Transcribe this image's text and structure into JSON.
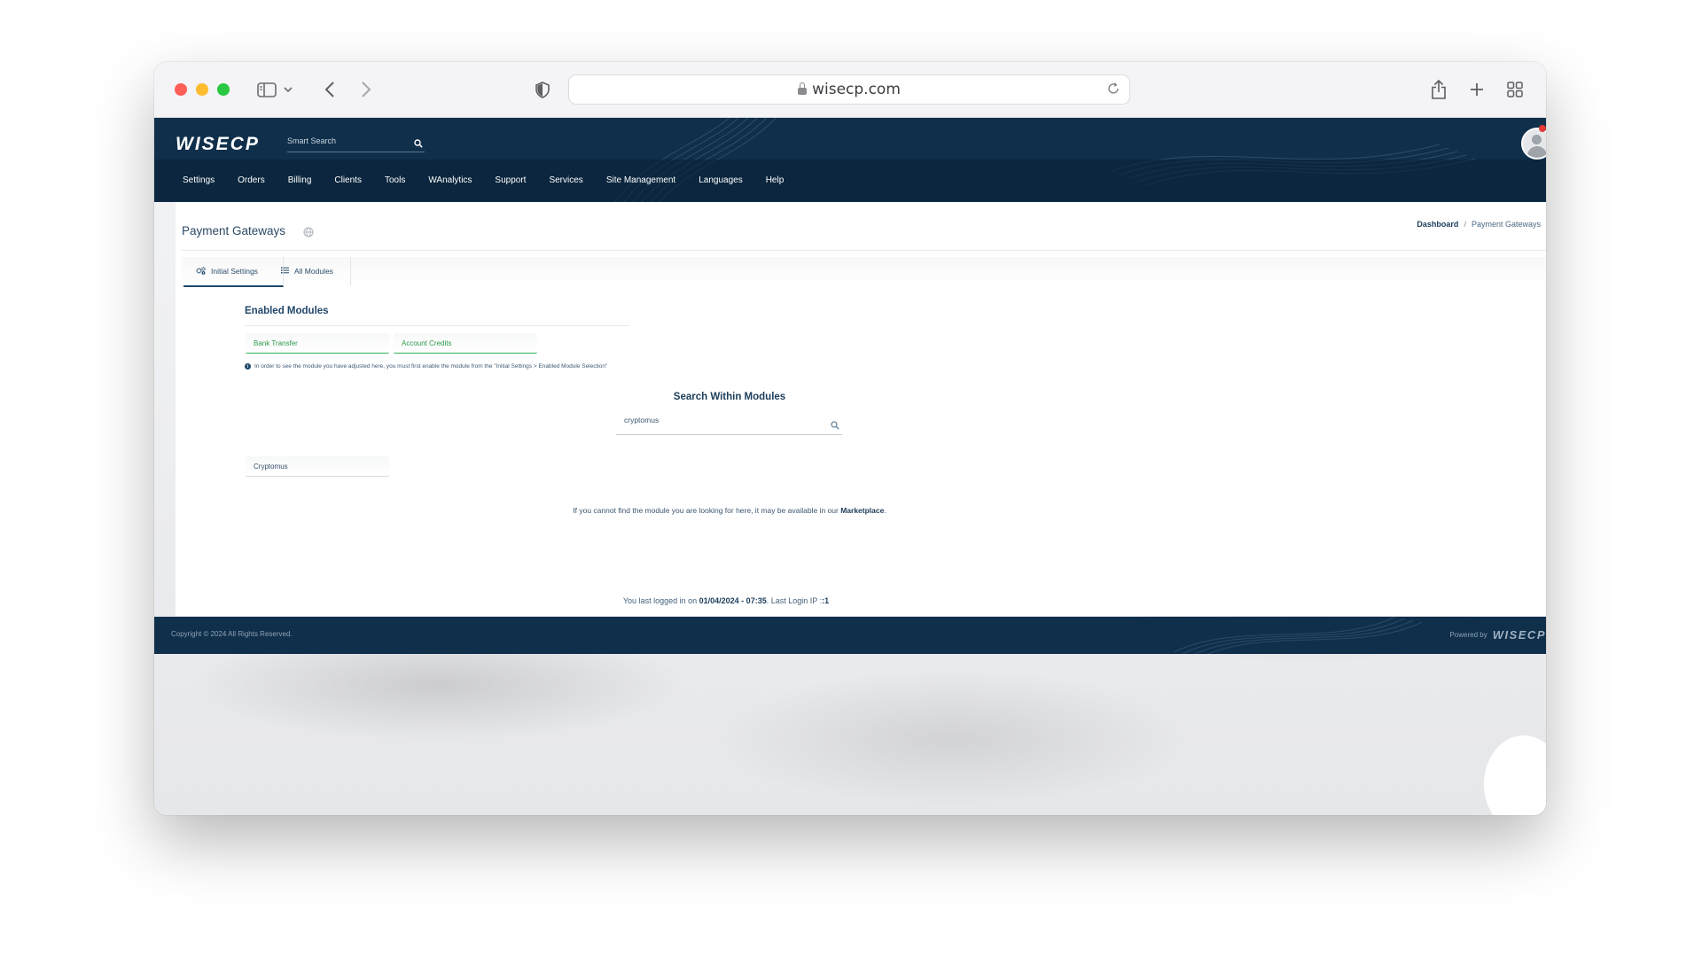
{
  "browser": {
    "url": "wisecp.com"
  },
  "header": {
    "logo": "WISECP",
    "search_placeholder": "Smart Search"
  },
  "menu": {
    "items": [
      "Settings",
      "Orders",
      "Billing",
      "Clients",
      "Tools",
      "WAnalytics",
      "Support",
      "Services",
      "Site Management",
      "Languages",
      "Help"
    ]
  },
  "page": {
    "title": "Payment Gateways",
    "breadcrumb": {
      "home": "Dashboard",
      "separator": "/",
      "current": "Payment Gateways"
    },
    "tabs": [
      {
        "label": "Initial Settings"
      },
      {
        "label": "All Modules"
      }
    ]
  },
  "enabled_modules": {
    "title": "Enabled Modules",
    "items": [
      "Bank Transfer",
      "Account Credits"
    ],
    "note": "In order to see the module you have adjusted here, you must first enable the module from the \"Initial Settings > Enabled Module Selection\""
  },
  "module_search": {
    "title": "Search Within Modules",
    "value": "cryptomus",
    "results": [
      "Cryptomus"
    ]
  },
  "marketplace_note": {
    "text": "If you cannot find the module you are looking for here, it may be available in our",
    "link": "Marketplace",
    "suffix": "."
  },
  "last_login": {
    "prefix": "You last logged in on",
    "datetime": "01/04/2024 - 07:35",
    "ip_label": ". Last Login IP :",
    "ip": ":1"
  },
  "footer": {
    "copyright": "Copyright © 2024 All Rights Reserved.",
    "powered_by": "Powered by",
    "logo": "WISECP"
  },
  "colors": {
    "navy": "#0f2f4b",
    "enabled_green": "#2fb35b"
  }
}
